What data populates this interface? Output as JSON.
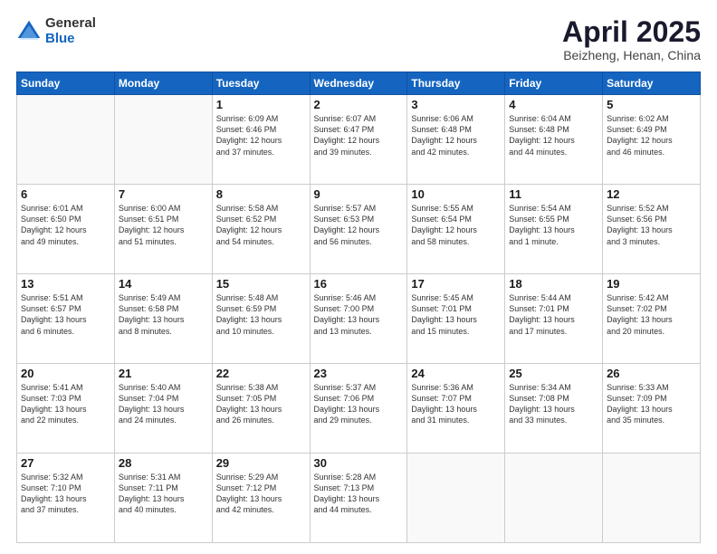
{
  "header": {
    "logo": {
      "general": "General",
      "blue": "Blue"
    },
    "title": "April 2025",
    "subtitle": "Beizheng, Henan, China"
  },
  "weekdays": [
    "Sunday",
    "Monday",
    "Tuesday",
    "Wednesday",
    "Thursday",
    "Friday",
    "Saturday"
  ],
  "weeks": [
    [
      {
        "day": "",
        "info": ""
      },
      {
        "day": "",
        "info": ""
      },
      {
        "day": "1",
        "info": "Sunrise: 6:09 AM\nSunset: 6:46 PM\nDaylight: 12 hours\nand 37 minutes."
      },
      {
        "day": "2",
        "info": "Sunrise: 6:07 AM\nSunset: 6:47 PM\nDaylight: 12 hours\nand 39 minutes."
      },
      {
        "day": "3",
        "info": "Sunrise: 6:06 AM\nSunset: 6:48 PM\nDaylight: 12 hours\nand 42 minutes."
      },
      {
        "day": "4",
        "info": "Sunrise: 6:04 AM\nSunset: 6:48 PM\nDaylight: 12 hours\nand 44 minutes."
      },
      {
        "day": "5",
        "info": "Sunrise: 6:02 AM\nSunset: 6:49 PM\nDaylight: 12 hours\nand 46 minutes."
      }
    ],
    [
      {
        "day": "6",
        "info": "Sunrise: 6:01 AM\nSunset: 6:50 PM\nDaylight: 12 hours\nand 49 minutes."
      },
      {
        "day": "7",
        "info": "Sunrise: 6:00 AM\nSunset: 6:51 PM\nDaylight: 12 hours\nand 51 minutes."
      },
      {
        "day": "8",
        "info": "Sunrise: 5:58 AM\nSunset: 6:52 PM\nDaylight: 12 hours\nand 54 minutes."
      },
      {
        "day": "9",
        "info": "Sunrise: 5:57 AM\nSunset: 6:53 PM\nDaylight: 12 hours\nand 56 minutes."
      },
      {
        "day": "10",
        "info": "Sunrise: 5:55 AM\nSunset: 6:54 PM\nDaylight: 12 hours\nand 58 minutes."
      },
      {
        "day": "11",
        "info": "Sunrise: 5:54 AM\nSunset: 6:55 PM\nDaylight: 13 hours\nand 1 minute."
      },
      {
        "day": "12",
        "info": "Sunrise: 5:52 AM\nSunset: 6:56 PM\nDaylight: 13 hours\nand 3 minutes."
      }
    ],
    [
      {
        "day": "13",
        "info": "Sunrise: 5:51 AM\nSunset: 6:57 PM\nDaylight: 13 hours\nand 6 minutes."
      },
      {
        "day": "14",
        "info": "Sunrise: 5:49 AM\nSunset: 6:58 PM\nDaylight: 13 hours\nand 8 minutes."
      },
      {
        "day": "15",
        "info": "Sunrise: 5:48 AM\nSunset: 6:59 PM\nDaylight: 13 hours\nand 10 minutes."
      },
      {
        "day": "16",
        "info": "Sunrise: 5:46 AM\nSunset: 7:00 PM\nDaylight: 13 hours\nand 13 minutes."
      },
      {
        "day": "17",
        "info": "Sunrise: 5:45 AM\nSunset: 7:01 PM\nDaylight: 13 hours\nand 15 minutes."
      },
      {
        "day": "18",
        "info": "Sunrise: 5:44 AM\nSunset: 7:01 PM\nDaylight: 13 hours\nand 17 minutes."
      },
      {
        "day": "19",
        "info": "Sunrise: 5:42 AM\nSunset: 7:02 PM\nDaylight: 13 hours\nand 20 minutes."
      }
    ],
    [
      {
        "day": "20",
        "info": "Sunrise: 5:41 AM\nSunset: 7:03 PM\nDaylight: 13 hours\nand 22 minutes."
      },
      {
        "day": "21",
        "info": "Sunrise: 5:40 AM\nSunset: 7:04 PM\nDaylight: 13 hours\nand 24 minutes."
      },
      {
        "day": "22",
        "info": "Sunrise: 5:38 AM\nSunset: 7:05 PM\nDaylight: 13 hours\nand 26 minutes."
      },
      {
        "day": "23",
        "info": "Sunrise: 5:37 AM\nSunset: 7:06 PM\nDaylight: 13 hours\nand 29 minutes."
      },
      {
        "day": "24",
        "info": "Sunrise: 5:36 AM\nSunset: 7:07 PM\nDaylight: 13 hours\nand 31 minutes."
      },
      {
        "day": "25",
        "info": "Sunrise: 5:34 AM\nSunset: 7:08 PM\nDaylight: 13 hours\nand 33 minutes."
      },
      {
        "day": "26",
        "info": "Sunrise: 5:33 AM\nSunset: 7:09 PM\nDaylight: 13 hours\nand 35 minutes."
      }
    ],
    [
      {
        "day": "27",
        "info": "Sunrise: 5:32 AM\nSunset: 7:10 PM\nDaylight: 13 hours\nand 37 minutes."
      },
      {
        "day": "28",
        "info": "Sunrise: 5:31 AM\nSunset: 7:11 PM\nDaylight: 13 hours\nand 40 minutes."
      },
      {
        "day": "29",
        "info": "Sunrise: 5:29 AM\nSunset: 7:12 PM\nDaylight: 13 hours\nand 42 minutes."
      },
      {
        "day": "30",
        "info": "Sunrise: 5:28 AM\nSunset: 7:13 PM\nDaylight: 13 hours\nand 44 minutes."
      },
      {
        "day": "",
        "info": ""
      },
      {
        "day": "",
        "info": ""
      },
      {
        "day": "",
        "info": ""
      }
    ]
  ]
}
